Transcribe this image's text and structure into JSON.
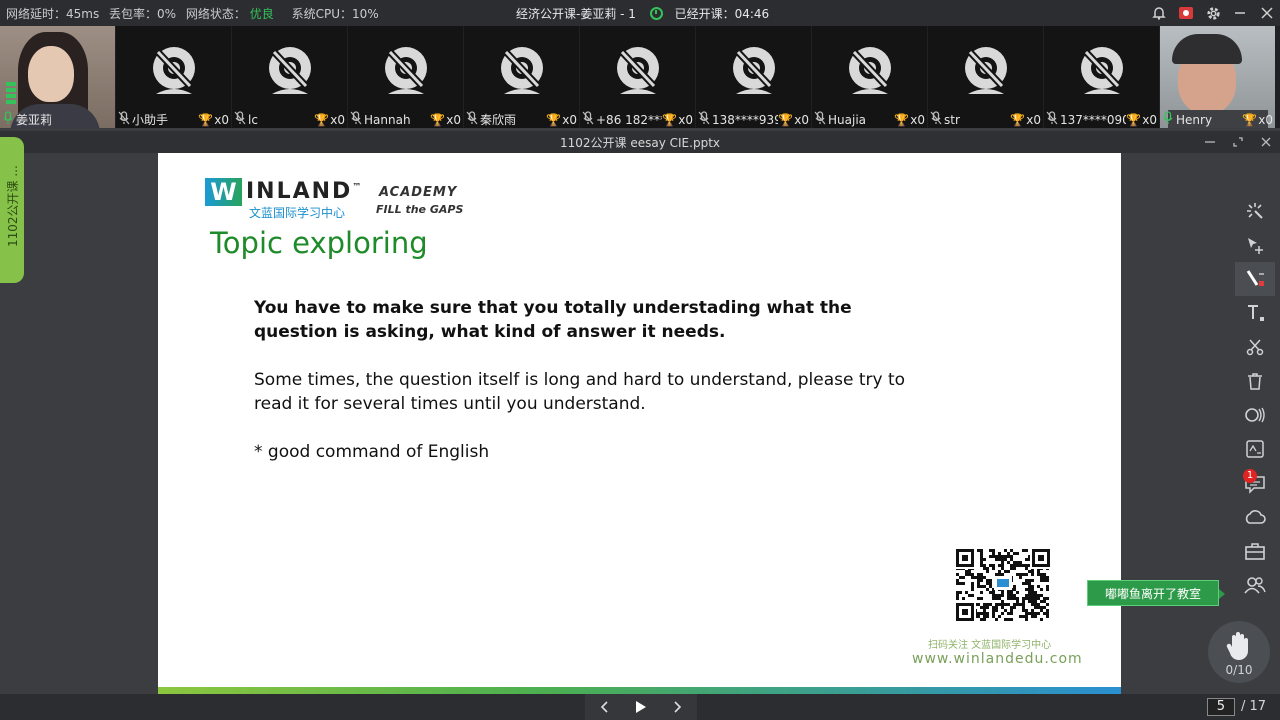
{
  "status": {
    "latency": "网络延时：45ms",
    "loss": "丢包率：0%",
    "net_label": "网络状态：",
    "net_value": "优良",
    "cpu": "系统CPU：10%",
    "class_title": "经济公开课-姜亚莉 - 1",
    "elapsed": "已经开课：04:46"
  },
  "participants": [
    {
      "name": "姜亚莉",
      "type": "video-female",
      "count": ""
    },
    {
      "name": "小助手",
      "type": "off",
      "count": "x0"
    },
    {
      "name": "lc",
      "type": "off",
      "count": "x0"
    },
    {
      "name": "Hannah",
      "type": "off",
      "count": "x0"
    },
    {
      "name": "秦欣雨",
      "type": "off",
      "count": "x0"
    },
    {
      "name": "+86 182****",
      "type": "off",
      "count": "x0"
    },
    {
      "name": "138****9395",
      "type": "off",
      "count": "x0"
    },
    {
      "name": "Huajia",
      "type": "off",
      "count": "x0"
    },
    {
      "name": "str",
      "type": "off",
      "count": "x0"
    },
    {
      "name": "137****0908",
      "type": "off",
      "count": "x0"
    },
    {
      "name": "Henry",
      "type": "video-male",
      "count": "x0"
    }
  ],
  "document": {
    "title": "1102公开课 eesay CIE.pptx",
    "side_tab": "1102公开课 ..."
  },
  "slide": {
    "logo_brand": "INLAND",
    "logo_tm": "™",
    "logo_academy": "ACADEMY",
    "logo_cn": "文蓝国际学习中心",
    "logo_fill": "FILL the GAPS",
    "heading": "Topic exploring",
    "para1": "You have to make sure that you totally understading what the question is asking, what kind of answer it needs.",
    "para2": "Some times, the question itself is long and hard to understand, please try to read it for several times until you understand.",
    "para3": "* good command of English",
    "qr_caption": "扫码关注 文蓝国际学习中心",
    "url": "www.winlandedu.com"
  },
  "notification": {
    "toast": "嘟嘟鱼离开了教室",
    "chat_badge": "1"
  },
  "hand_raise": {
    "count": "0/10"
  },
  "pager": {
    "current": "5",
    "total": "/ 17"
  },
  "colors": {
    "accent_green": "#35c25a",
    "heading_green": "#1f8a2a",
    "toast_green": "#2c9a48"
  }
}
